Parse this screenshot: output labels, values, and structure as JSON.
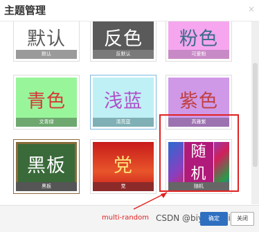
{
  "dialog": {
    "title": "主题管理",
    "close": "×"
  },
  "themes": [
    {
      "big": "默认",
      "cap": "默认",
      "bg": "#ffffff",
      "fg": "#5b5b5b",
      "capbg": "#9a9a9a"
    },
    {
      "big": "反色",
      "cap": "反默认",
      "bg": "#5a5a5a",
      "fg": "#ffffff",
      "capbg": "#7a7a7a"
    },
    {
      "big": "粉色",
      "cap": "可爱粉",
      "bg": "#f5a6ef",
      "fg": "#3a6b8a",
      "capbg": "#c88ac6"
    },
    {
      "big": "青色",
      "cap": "文青绿",
      "bg": "#99f59a",
      "fg": "#d33a3a",
      "capbg": "#6ea86f"
    },
    {
      "big": "浅蓝",
      "cap": "清亮蓝",
      "bg": "#bff0f5",
      "fg": "#b050c8",
      "capbg": "#7fb0b5"
    },
    {
      "big": "紫色",
      "cap": "高雅紫",
      "bg": "#cf99e8",
      "fg": "#c04040",
      "capbg": "#9c72b0"
    },
    {
      "big": "黑板",
      "cap": "黑板",
      "bg": "#3a6a3a",
      "fg": "#ffffff",
      "capbg": "#555555"
    },
    {
      "big": "党",
      "cap": "党",
      "bg": "#c81b1b",
      "fg": "#ffe27a",
      "capbg": "#8c2a2a"
    },
    {
      "big": "随机",
      "cap": "随机",
      "bg": "#6a3fa8",
      "fg": "#ffffff",
      "capbg": "#666666"
    }
  ],
  "annotation": {
    "label": "multi-random"
  },
  "footer": {
    "ok": "确定",
    "cancel": "关闭",
    "watermark": "CSDN @biyezuopin"
  }
}
